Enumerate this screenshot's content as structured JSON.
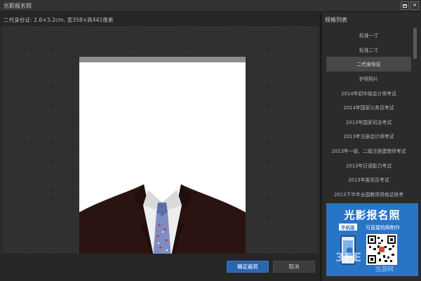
{
  "window": {
    "title": "光影报名照",
    "maximize_icon": "maximize-icon",
    "close_icon": "close-icon"
  },
  "info": {
    "spec_text": "二代身份证: 2.6×3.2cm, 宽358×高441像素"
  },
  "buttons": {
    "confirm": "确定裁剪",
    "cancel": "取消"
  },
  "panel": {
    "title": "规格列表",
    "items": [
      {
        "label": "标准一寸"
      },
      {
        "label": "标准二寸"
      },
      {
        "label": "二代身份证"
      },
      {
        "label": "护照照片"
      },
      {
        "label": "2014年初中级会计师考试"
      },
      {
        "label": "2014年国家公务员考试"
      },
      {
        "label": "2013年国家司法考试"
      },
      {
        "label": "2013年注册会计师考试"
      },
      {
        "label": "2013年一级、二级注册建筑师考试"
      },
      {
        "label": "2013年日语能力考试"
      },
      {
        "label": "2013年报关员考试"
      },
      {
        "label": "2013下半年全国教师资格证统考"
      }
    ],
    "selected_index": 2
  },
  "ad": {
    "title": "光影报名照",
    "badge": "手机版",
    "slogan": "可直接拍照制作"
  },
  "watermark": {
    "text": "3FE",
    "sub": "当游网"
  },
  "colors": {
    "accent": "#2c64b4",
    "ad_background": "#2a74c8",
    "selected_row": "#484848"
  }
}
